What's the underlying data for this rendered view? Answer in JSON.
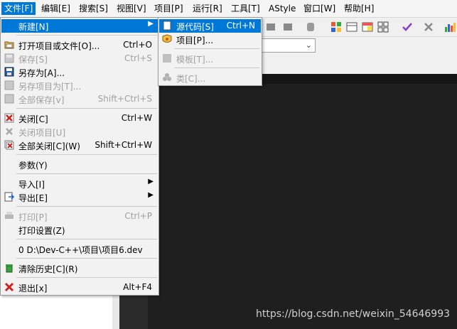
{
  "menubar": [
    {
      "label": "文件[F]",
      "active": true
    },
    {
      "label": "编辑[E]"
    },
    {
      "label": "搜索[S]"
    },
    {
      "label": "视图[V]"
    },
    {
      "label": "项目[P]"
    },
    {
      "label": "运行[R]"
    },
    {
      "label": "工具[T]"
    },
    {
      "label": "AStyle"
    },
    {
      "label": "窗口[W]"
    },
    {
      "label": "帮助[H]"
    }
  ],
  "file_menu": [
    {
      "label": "新建[N]",
      "submenu": true,
      "highlight": true
    },
    {
      "label": "打开项目或文件[O]...",
      "shortcut": "Ctrl+O",
      "icon": "open-folder-icon"
    },
    {
      "label": "保存[S]",
      "shortcut": "Ctrl+S",
      "disabled": true,
      "icon": "save-icon"
    },
    {
      "label": "另存为[A]...",
      "icon": "save-as-icon"
    },
    {
      "label": "另存项目为[T]...",
      "disabled": true,
      "icon": "save-project-icon"
    },
    {
      "label": "全部保存[v]",
      "shortcut": "Shift+Ctrl+S",
      "disabled": true,
      "icon": "save-all-icon"
    },
    {
      "label": "关闭[C]",
      "shortcut": "Ctrl+W",
      "icon": "close-icon"
    },
    {
      "label": "关闭项目[U]",
      "disabled": true,
      "icon": "close-project-icon"
    },
    {
      "label": "全部关闭[C](W)",
      "shortcut": "Shift+Ctrl+W",
      "icon": "close-all-icon"
    },
    {
      "label": "参数(Y)"
    },
    {
      "label": "导入[I]",
      "submenu": true
    },
    {
      "label": "导出[E]",
      "submenu": true,
      "icon": "export-icon"
    },
    {
      "label": "打印[P]",
      "shortcut": "Ctrl+P",
      "disabled": true,
      "icon": "print-icon"
    },
    {
      "label": "打印设置(Z)"
    },
    {
      "label": "0 D:\\Dev-C++\\项目\\项目6.dev"
    },
    {
      "label": "清除历史[C](R)",
      "icon": "clear-history-icon"
    },
    {
      "label": "退出[x]",
      "shortcut": "Alt+F4",
      "icon": "exit-icon"
    }
  ],
  "new_submenu": [
    {
      "label": "源代码[S]",
      "shortcut": "Ctrl+N",
      "highlight": true,
      "icon": "source-file-icon"
    },
    {
      "label": "项目[P]...",
      "icon": "project-icon"
    },
    {
      "label": "模板[T]...",
      "disabled": true,
      "icon": "template-icon"
    },
    {
      "label": "类[C]...",
      "disabled": true,
      "icon": "class-icon"
    }
  ],
  "watermark": "https://blog.csdn.net/weixin_54646993",
  "colors": {
    "highlight": "#0078d7",
    "editor_bg": "#1f1f1f",
    "menu_bg": "#f2f2f2"
  }
}
